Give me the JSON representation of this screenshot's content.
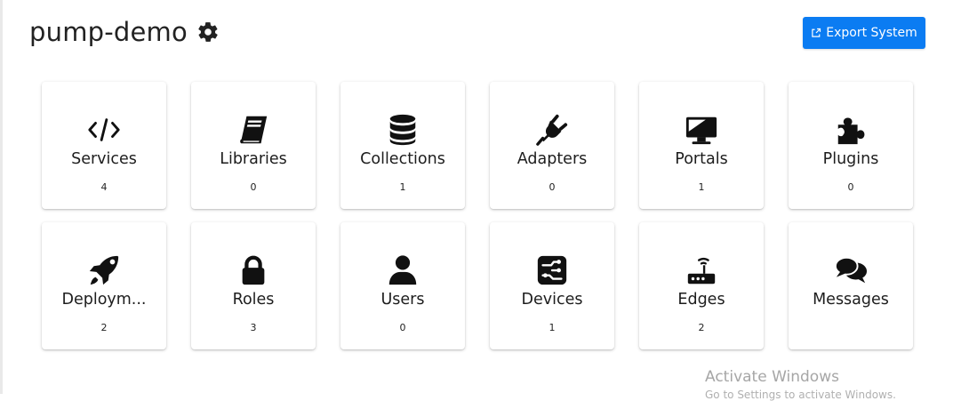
{
  "header": {
    "title": "pump-demo",
    "settings_icon": "gear-icon",
    "export_button": {
      "label": "Export System",
      "icon": "external-link-icon"
    }
  },
  "colors": {
    "accent": "#0b7cf2",
    "text": "#212121",
    "watermark": "#a6a6a6"
  },
  "tiles": [
    {
      "label": "Services",
      "count": "4",
      "icon": "code-icon"
    },
    {
      "label": "Libraries",
      "count": "0",
      "icon": "book-icon"
    },
    {
      "label": "Collections",
      "count": "1",
      "icon": "database-icon"
    },
    {
      "label": "Adapters",
      "count": "0",
      "icon": "plug-icon"
    },
    {
      "label": "Portals",
      "count": "1",
      "icon": "desktop-icon"
    },
    {
      "label": "Plugins",
      "count": "0",
      "icon": "puzzle-icon"
    },
    {
      "label": "Deploym...",
      "count": "2",
      "icon": "rocket-icon"
    },
    {
      "label": "Roles",
      "count": "3",
      "icon": "lock-icon"
    },
    {
      "label": "Users",
      "count": "0",
      "icon": "user-icon"
    },
    {
      "label": "Devices",
      "count": "1",
      "icon": "device-icon"
    },
    {
      "label": "Edges",
      "count": "2",
      "icon": "router-icon"
    },
    {
      "label": "Messages",
      "count": "",
      "icon": "comments-icon"
    }
  ],
  "watermark": {
    "title": "Activate Windows",
    "subtitle": "Go to Settings to activate Windows."
  }
}
